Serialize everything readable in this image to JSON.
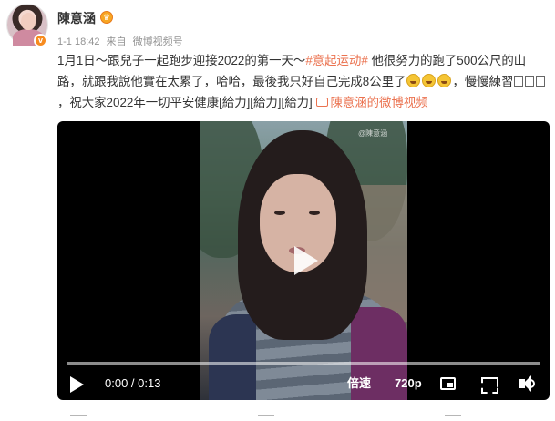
{
  "user": {
    "name": "陳意涵"
  },
  "post": {
    "meta": {
      "date": "1-1 18:42",
      "source_prefix": "来自",
      "source": "微博视频号"
    },
    "text": {
      "part1": "1月1日～跟兒子一起跑步迎接2022的第一天～",
      "topic": "#意起运动#",
      "part2": " 他很努力的跑了500公尺的山路，就跟我說他實在太累了，哈哈，最後我只好自己完成8公里了",
      "part3": "，慢慢練習",
      "part4": "，祝大家2022年一切平安健康[給力][給力][給力]",
      "video_link": "陳意涵的微博视频"
    }
  },
  "video": {
    "watermark": "@陳意涵",
    "time": "0:00 / 0:13",
    "speed_label": "倍速",
    "quality_label": "720p",
    "progress": 0
  },
  "icons": {
    "vip": "vip-badge-icon",
    "verified": "verified-badge-icon",
    "laugh_cry": "laugh-cry-emoji-icon",
    "unsupported_glyph": "missing-character-icon",
    "video_link": "video-link-icon",
    "play": "play-icon",
    "picture_in_picture": "picture-in-picture-icon",
    "fullscreen": "fullscreen-icon",
    "volume": "volume-icon"
  },
  "colors": {
    "topic": "#eb7350",
    "player_bg": "#000000",
    "meta_text": "#939393"
  }
}
